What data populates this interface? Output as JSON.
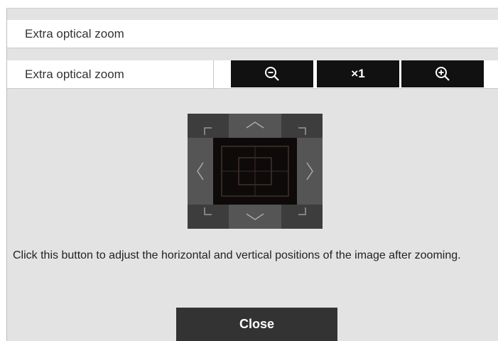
{
  "header": {
    "title": "Extra optical zoom"
  },
  "zoom_row": {
    "label": "Extra optical zoom",
    "buttons": [
      {
        "icon": "zoom-out-icon"
      },
      {
        "label": "×1"
      },
      {
        "icon": "zoom-in-icon"
      }
    ]
  },
  "position_pad": {
    "icons": [
      "arrow-up-icon",
      "arrow-down-icon",
      "arrow-left-icon",
      "arrow-right-icon",
      "corner-marks"
    ]
  },
  "hint": {
    "text": "Click this button to adjust the horizontal and vertical positions of the image after zooming."
  },
  "close": {
    "label": "Close"
  },
  "colors": {
    "panel_bg": "#e3e3e3",
    "button_bg": "#111111",
    "close_bg": "#333333"
  }
}
